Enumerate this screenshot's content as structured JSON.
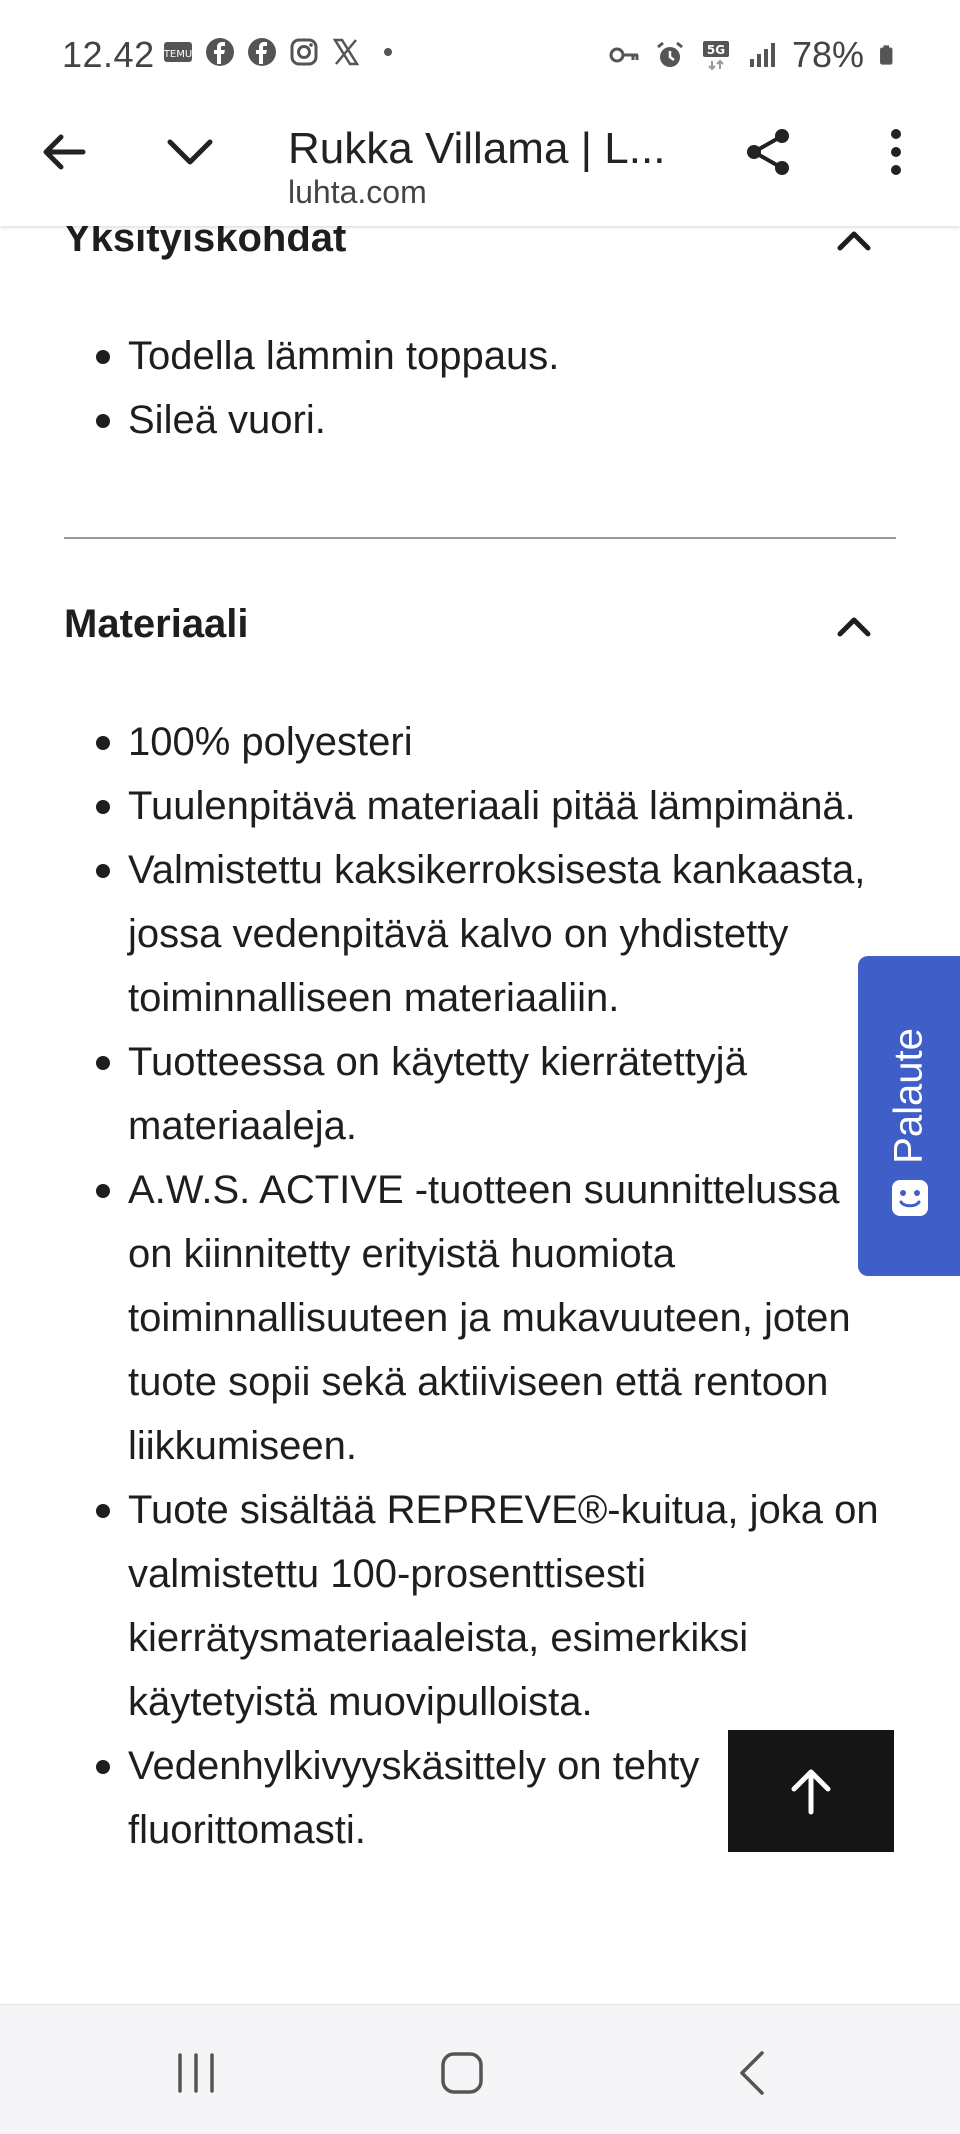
{
  "status_bar": {
    "time": "12.42",
    "battery": "78%",
    "network": "5G"
  },
  "browser": {
    "title": "Rukka Villama | L...",
    "url": "luhta.com"
  },
  "sections": {
    "features": {
      "heading": "Yksityiskohdat",
      "items": [
        "Todella lämmin toppaus.",
        "Sileä vuori."
      ]
    },
    "material": {
      "heading": "Materiaali",
      "items": [
        "100% polyesteri",
        "Tuulenpitävä materiaali pitää lämpimänä.",
        "Valmistettu kaksikerroksisesta kankaasta, jossa vedenpitävä kalvo on yhdistetty toiminnalliseen materiaaliin.",
        "Tuotteessa on käytetty kierrätettyjä materiaaleja.",
        "A.W.S. ACTIVE -tuotteen suunnittelussa on kiinnitetty erityistä huomiota toiminnallisuuteen ja mukavuuteen, joten tuote sopii sekä aktiiviseen että rentoon liikkumiseen.",
        "Tuote sisältää REPREVE®-kuitua, joka on valmistettu 100-prosenttisesti kierrätysmateriaaleista, esimerkiksi käytetyistä muovipulloista.",
        "Vedenhylkivyyskäsittely on tehty fluorittomasti."
      ]
    }
  },
  "feedback": {
    "label": "Palaute"
  },
  "colors": {
    "feedback_bg": "#3f5ec7",
    "back_to_top_bg": "#151515"
  },
  "icons": [
    "arrow-left-icon",
    "chevron-down-icon",
    "share-icon",
    "more-vert-icon",
    "chevron-up-icon",
    "arrow-up-icon",
    "smiley-icon",
    "recents-icon",
    "home-icon",
    "back-icon"
  ]
}
